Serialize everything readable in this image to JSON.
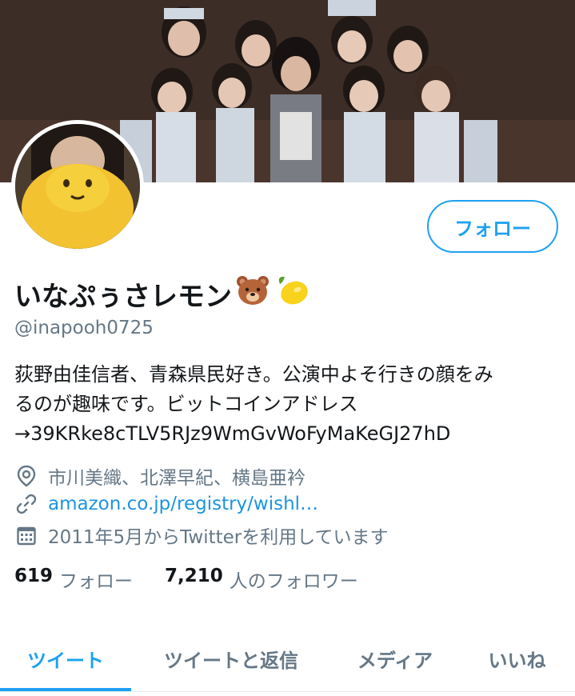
{
  "profile": {
    "display_name": "いなぷぅさレモン",
    "name_emojis": [
      "bear-face-emoji",
      "lemon-emoji"
    ],
    "handle": "@inapooh0725",
    "bio_lines": [
      "荻野由佳信者、青森県民好き。公演中よそ行きの顔をみ",
      "るのが趣味です。ビットコインアドレス",
      "→39KRke8cTLV5RJz9WmGvWoFyMaKeGJ27hD"
    ],
    "location": "市川美織、北澤早紀、横島亜衿",
    "website": "amazon.co.jp/registry/wishl…",
    "joined": "2011年5月からTwitterを利用しています",
    "following_count": "619",
    "following_label": "フォロー",
    "followers_count": "7,210",
    "followers_label": "人のフォロワー"
  },
  "actions": {
    "follow_label": "フォロー"
  },
  "tabs": [
    {
      "label": "ツイート",
      "active": true
    },
    {
      "label": "ツイートと返信",
      "active": false
    },
    {
      "label": "メディア",
      "active": false
    },
    {
      "label": "いいね",
      "active": false
    }
  ],
  "colors": {
    "accent": "#1da1f2",
    "link": "#1b95e0",
    "secondary_text": "#657786",
    "primary_text": "#14171a"
  },
  "icons": {
    "location": "location-pin-icon",
    "link": "link-icon",
    "calendar": "calendar-icon"
  }
}
